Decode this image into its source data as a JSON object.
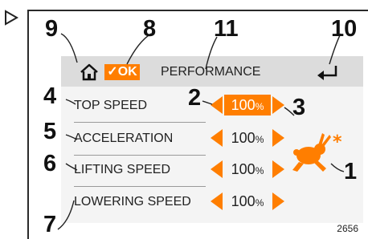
{
  "screen": {
    "title": "PERFORMANCE",
    "ok_label": "✓OK",
    "home_icon": "home-icon",
    "back_icon": "back-icon"
  },
  "rows": [
    {
      "label": "TOP SPEED",
      "value": "100",
      "unit": "%",
      "selected": true
    },
    {
      "label": "ACCELERATION",
      "value": "100",
      "unit": "%",
      "selected": false
    },
    {
      "label": "LIFTING SPEED",
      "value": "100",
      "unit": "%",
      "selected": false
    },
    {
      "label": "LOWERING SPEED",
      "value": "100",
      "unit": "%",
      "selected": false
    }
  ],
  "mode_icon": {
    "name": "rabbit-icon",
    "color": "#ff7e00"
  },
  "accent_color": "#ff7e00",
  "callouts": {
    "c1": "1",
    "c2": "2",
    "c3": "3",
    "c4": "4",
    "c5": "5",
    "c6": "6",
    "c7": "7",
    "c8": "8",
    "c9": "9",
    "c10": "10",
    "c11": "11"
  },
  "figure_id": "2656"
}
